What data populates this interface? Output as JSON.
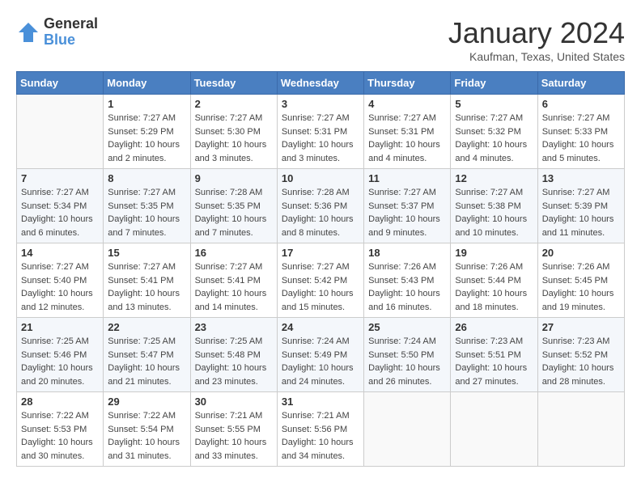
{
  "header": {
    "logo_general": "General",
    "logo_blue": "Blue",
    "month_title": "January 2024",
    "location": "Kaufman, Texas, United States"
  },
  "days_of_week": [
    "Sunday",
    "Monday",
    "Tuesday",
    "Wednesday",
    "Thursday",
    "Friday",
    "Saturday"
  ],
  "weeks": [
    [
      {
        "day": "",
        "info": ""
      },
      {
        "day": "1",
        "info": "Sunrise: 7:27 AM\nSunset: 5:29 PM\nDaylight: 10 hours\nand 2 minutes."
      },
      {
        "day": "2",
        "info": "Sunrise: 7:27 AM\nSunset: 5:30 PM\nDaylight: 10 hours\nand 3 minutes."
      },
      {
        "day": "3",
        "info": "Sunrise: 7:27 AM\nSunset: 5:31 PM\nDaylight: 10 hours\nand 3 minutes."
      },
      {
        "day": "4",
        "info": "Sunrise: 7:27 AM\nSunset: 5:31 PM\nDaylight: 10 hours\nand 4 minutes."
      },
      {
        "day": "5",
        "info": "Sunrise: 7:27 AM\nSunset: 5:32 PM\nDaylight: 10 hours\nand 4 minutes."
      },
      {
        "day": "6",
        "info": "Sunrise: 7:27 AM\nSunset: 5:33 PM\nDaylight: 10 hours\nand 5 minutes."
      }
    ],
    [
      {
        "day": "7",
        "info": "Sunrise: 7:27 AM\nSunset: 5:34 PM\nDaylight: 10 hours\nand 6 minutes."
      },
      {
        "day": "8",
        "info": "Sunrise: 7:27 AM\nSunset: 5:35 PM\nDaylight: 10 hours\nand 7 minutes."
      },
      {
        "day": "9",
        "info": "Sunrise: 7:28 AM\nSunset: 5:35 PM\nDaylight: 10 hours\nand 7 minutes."
      },
      {
        "day": "10",
        "info": "Sunrise: 7:28 AM\nSunset: 5:36 PM\nDaylight: 10 hours\nand 8 minutes."
      },
      {
        "day": "11",
        "info": "Sunrise: 7:27 AM\nSunset: 5:37 PM\nDaylight: 10 hours\nand 9 minutes."
      },
      {
        "day": "12",
        "info": "Sunrise: 7:27 AM\nSunset: 5:38 PM\nDaylight: 10 hours\nand 10 minutes."
      },
      {
        "day": "13",
        "info": "Sunrise: 7:27 AM\nSunset: 5:39 PM\nDaylight: 10 hours\nand 11 minutes."
      }
    ],
    [
      {
        "day": "14",
        "info": "Sunrise: 7:27 AM\nSunset: 5:40 PM\nDaylight: 10 hours\nand 12 minutes."
      },
      {
        "day": "15",
        "info": "Sunrise: 7:27 AM\nSunset: 5:41 PM\nDaylight: 10 hours\nand 13 minutes."
      },
      {
        "day": "16",
        "info": "Sunrise: 7:27 AM\nSunset: 5:41 PM\nDaylight: 10 hours\nand 14 minutes."
      },
      {
        "day": "17",
        "info": "Sunrise: 7:27 AM\nSunset: 5:42 PM\nDaylight: 10 hours\nand 15 minutes."
      },
      {
        "day": "18",
        "info": "Sunrise: 7:26 AM\nSunset: 5:43 PM\nDaylight: 10 hours\nand 16 minutes."
      },
      {
        "day": "19",
        "info": "Sunrise: 7:26 AM\nSunset: 5:44 PM\nDaylight: 10 hours\nand 18 minutes."
      },
      {
        "day": "20",
        "info": "Sunrise: 7:26 AM\nSunset: 5:45 PM\nDaylight: 10 hours\nand 19 minutes."
      }
    ],
    [
      {
        "day": "21",
        "info": "Sunrise: 7:25 AM\nSunset: 5:46 PM\nDaylight: 10 hours\nand 20 minutes."
      },
      {
        "day": "22",
        "info": "Sunrise: 7:25 AM\nSunset: 5:47 PM\nDaylight: 10 hours\nand 21 minutes."
      },
      {
        "day": "23",
        "info": "Sunrise: 7:25 AM\nSunset: 5:48 PM\nDaylight: 10 hours\nand 23 minutes."
      },
      {
        "day": "24",
        "info": "Sunrise: 7:24 AM\nSunset: 5:49 PM\nDaylight: 10 hours\nand 24 minutes."
      },
      {
        "day": "25",
        "info": "Sunrise: 7:24 AM\nSunset: 5:50 PM\nDaylight: 10 hours\nand 26 minutes."
      },
      {
        "day": "26",
        "info": "Sunrise: 7:23 AM\nSunset: 5:51 PM\nDaylight: 10 hours\nand 27 minutes."
      },
      {
        "day": "27",
        "info": "Sunrise: 7:23 AM\nSunset: 5:52 PM\nDaylight: 10 hours\nand 28 minutes."
      }
    ],
    [
      {
        "day": "28",
        "info": "Sunrise: 7:22 AM\nSunset: 5:53 PM\nDaylight: 10 hours\nand 30 minutes."
      },
      {
        "day": "29",
        "info": "Sunrise: 7:22 AM\nSunset: 5:54 PM\nDaylight: 10 hours\nand 31 minutes."
      },
      {
        "day": "30",
        "info": "Sunrise: 7:21 AM\nSunset: 5:55 PM\nDaylight: 10 hours\nand 33 minutes."
      },
      {
        "day": "31",
        "info": "Sunrise: 7:21 AM\nSunset: 5:56 PM\nDaylight: 10 hours\nand 34 minutes."
      },
      {
        "day": "",
        "info": ""
      },
      {
        "day": "",
        "info": ""
      },
      {
        "day": "",
        "info": ""
      }
    ]
  ]
}
